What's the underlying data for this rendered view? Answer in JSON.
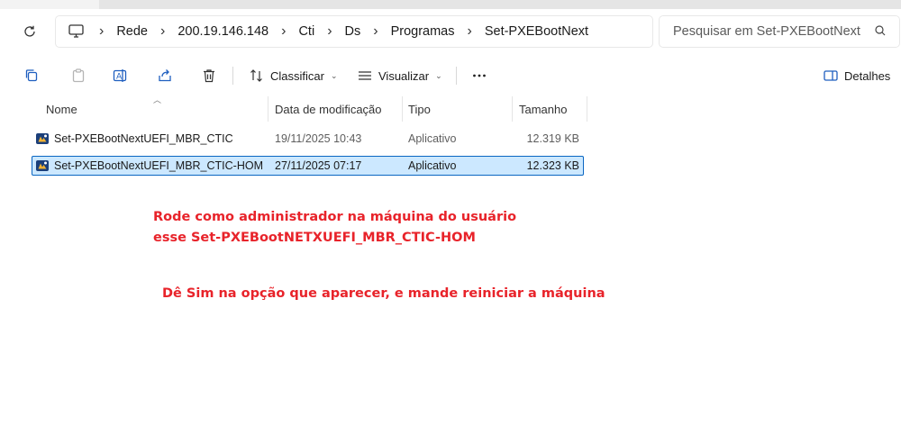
{
  "breadcrumb": {
    "items": [
      "Rede",
      "200.19.146.148",
      "Cti",
      "Ds",
      "Programas",
      "Set-PXEBootNext"
    ]
  },
  "search": {
    "placeholder": "Pesquisar em Set-PXEBootNext"
  },
  "toolbar": {
    "sort_label": "Classificar",
    "view_label": "Visualizar",
    "details_label": "Detalhes"
  },
  "columns": {
    "name": "Nome",
    "modified": "Data de modificação",
    "type": "Tipo",
    "size": "Tamanho"
  },
  "files": [
    {
      "name": "Set-PXEBootNextUEFI_MBR_CTIC",
      "modified": "19/11/2025 10:43",
      "type": "Aplicativo",
      "size": "12.319 KB",
      "selected": false
    },
    {
      "name": "Set-PXEBootNextUEFI_MBR_CTIC-HOM",
      "modified": "27/11/2025 07:17",
      "type": "Aplicativo",
      "size": "12.323 KB",
      "selected": true
    }
  ],
  "annotation": {
    "line1": "Rode como administrador na máquina do usuário",
    "line2": "esse Set-PXEBootNETXUEFI_MBR_CTIC-HOM",
    "line3": "Dê Sim na opção que aparecer, e mande reiniciar a máquina"
  },
  "colors": {
    "annotation": "#e8232a",
    "selection_bg": "#cce8ff",
    "selection_border": "#0a66c2"
  }
}
